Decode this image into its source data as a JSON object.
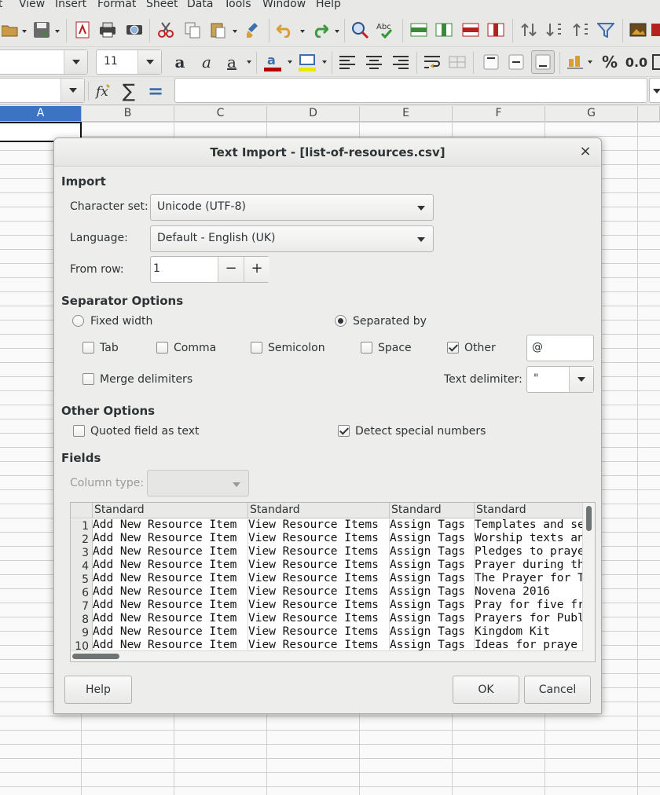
{
  "menubar": {
    "items": [
      "Insert",
      "View",
      "Insert",
      "Format",
      "Sheet",
      "Data",
      "Tools",
      "Window",
      "Help"
    ]
  },
  "toolbar": {
    "font_size": "11",
    "percent_label": "%",
    "decimal_label": "0.0"
  },
  "formula_bar": {
    "sum_symbol": "∑",
    "equals_symbol": "="
  },
  "sheet": {
    "columns": [
      "A",
      "B",
      "C",
      "D",
      "E",
      "F",
      "G"
    ],
    "selected_column": "A"
  },
  "dialog": {
    "title": "Text Import - [list-of-resources.csv]",
    "close_symbol": "×",
    "import": {
      "heading": "Import",
      "charset_label": "Character set:",
      "charset_value": "Unicode (UTF-8)",
      "language_label": "Language:",
      "language_value": "Default - English (UK)",
      "from_row_label": "From row:",
      "from_row_value": "1",
      "minus": "−",
      "plus": "+"
    },
    "separator": {
      "heading": "Separator Options",
      "fixed_width": "Fixed width",
      "separated_by": "Separated by",
      "mode": "separated_by",
      "tab": "Tab",
      "comma": "Comma",
      "semicolon": "Semicolon",
      "space": "Space",
      "other": "Other",
      "tab_checked": false,
      "comma_checked": false,
      "semicolon_checked": false,
      "space_checked": false,
      "other_checked": true,
      "other_value": "@",
      "merge_delimiters": "Merge delimiters",
      "merge_checked": false,
      "text_delimiter_label": "Text delimiter:",
      "text_delimiter_value": "\""
    },
    "other_options": {
      "heading": "Other Options",
      "quoted_as_text": "Quoted field as text",
      "quoted_checked": false,
      "detect_special": "Detect special numbers",
      "detect_checked": true
    },
    "fields": {
      "heading": "Fields",
      "column_type_label": "Column type:",
      "column_type_value": "",
      "headers": [
        "Standard",
        "Standard",
        "Standard",
        "Standard"
      ],
      "rows": [
        {
          "n": "1",
          "c": [
            "Add New Resource Item",
            "View Resource Items",
            "Assign Tags",
            "Templates and se"
          ]
        },
        {
          "n": "2",
          "c": [
            "Add New Resource Item",
            "View Resource Items",
            "Assign Tags",
            "Worship texts an"
          ]
        },
        {
          "n": "3",
          "c": [
            "Add New Resource Item",
            "View Resource Items",
            "Assign Tags",
            "Pledges to praye"
          ]
        },
        {
          "n": "4",
          "c": [
            "Add New Resource Item",
            "View Resource Items",
            "Assign Tags",
            "Prayer during th"
          ]
        },
        {
          "n": "5",
          "c": [
            "Add New Resource Item",
            "View Resource Items",
            "Assign Tags",
            "The Prayer for T"
          ]
        },
        {
          "n": "6",
          "c": [
            "Add New Resource Item",
            "View Resource Items",
            "Assign Tags",
            "Novena 2016"
          ]
        },
        {
          "n": "7",
          "c": [
            "Add New Resource Item",
            "View Resource Items",
            "Assign Tags",
            "Pray for five fr"
          ]
        },
        {
          "n": "8",
          "c": [
            "Add New Resource Item",
            "View Resource Items",
            "Assign Tags",
            "Prayers for Publ"
          ]
        },
        {
          "n": "9",
          "c": [
            "Add New Resource Item",
            "View Resource Items",
            "Assign Tags",
            "Kingdom Kit"
          ]
        },
        {
          "n": "10",
          "c": [
            "Add New Resource Item",
            "View Resource Items",
            "Assign Tags",
            "Ideas for praye"
          ]
        }
      ]
    },
    "buttons": {
      "help": "Help",
      "ok": "OK",
      "cancel": "Cancel"
    }
  },
  "colors": {
    "selection_blue": "#3b74c2",
    "dialog_bg": "#ededec"
  }
}
